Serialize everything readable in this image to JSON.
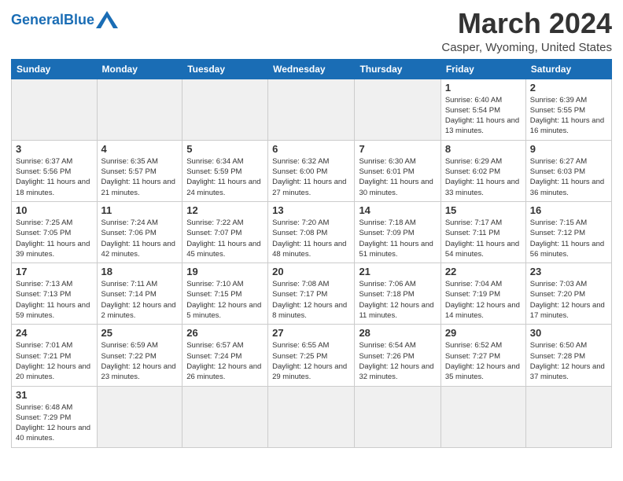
{
  "header": {
    "logo_text_general": "General",
    "logo_text_blue": "Blue",
    "month_title": "March 2024",
    "location": "Casper, Wyoming, United States"
  },
  "weekdays": [
    "Sunday",
    "Monday",
    "Tuesday",
    "Wednesday",
    "Thursday",
    "Friday",
    "Saturday"
  ],
  "weeks": [
    [
      {
        "day": "",
        "info": ""
      },
      {
        "day": "",
        "info": ""
      },
      {
        "day": "",
        "info": ""
      },
      {
        "day": "",
        "info": ""
      },
      {
        "day": "",
        "info": ""
      },
      {
        "day": "1",
        "info": "Sunrise: 6:40 AM\nSunset: 5:54 PM\nDaylight: 11 hours and 13 minutes."
      },
      {
        "day": "2",
        "info": "Sunrise: 6:39 AM\nSunset: 5:55 PM\nDaylight: 11 hours and 16 minutes."
      }
    ],
    [
      {
        "day": "3",
        "info": "Sunrise: 6:37 AM\nSunset: 5:56 PM\nDaylight: 11 hours and 18 minutes."
      },
      {
        "day": "4",
        "info": "Sunrise: 6:35 AM\nSunset: 5:57 PM\nDaylight: 11 hours and 21 minutes."
      },
      {
        "day": "5",
        "info": "Sunrise: 6:34 AM\nSunset: 5:59 PM\nDaylight: 11 hours and 24 minutes."
      },
      {
        "day": "6",
        "info": "Sunrise: 6:32 AM\nSunset: 6:00 PM\nDaylight: 11 hours and 27 minutes."
      },
      {
        "day": "7",
        "info": "Sunrise: 6:30 AM\nSunset: 6:01 PM\nDaylight: 11 hours and 30 minutes."
      },
      {
        "day": "8",
        "info": "Sunrise: 6:29 AM\nSunset: 6:02 PM\nDaylight: 11 hours and 33 minutes."
      },
      {
        "day": "9",
        "info": "Sunrise: 6:27 AM\nSunset: 6:03 PM\nDaylight: 11 hours and 36 minutes."
      }
    ],
    [
      {
        "day": "10",
        "info": "Sunrise: 7:25 AM\nSunset: 7:05 PM\nDaylight: 11 hours and 39 minutes."
      },
      {
        "day": "11",
        "info": "Sunrise: 7:24 AM\nSunset: 7:06 PM\nDaylight: 11 hours and 42 minutes."
      },
      {
        "day": "12",
        "info": "Sunrise: 7:22 AM\nSunset: 7:07 PM\nDaylight: 11 hours and 45 minutes."
      },
      {
        "day": "13",
        "info": "Sunrise: 7:20 AM\nSunset: 7:08 PM\nDaylight: 11 hours and 48 minutes."
      },
      {
        "day": "14",
        "info": "Sunrise: 7:18 AM\nSunset: 7:09 PM\nDaylight: 11 hours and 51 minutes."
      },
      {
        "day": "15",
        "info": "Sunrise: 7:17 AM\nSunset: 7:11 PM\nDaylight: 11 hours and 54 minutes."
      },
      {
        "day": "16",
        "info": "Sunrise: 7:15 AM\nSunset: 7:12 PM\nDaylight: 11 hours and 56 minutes."
      }
    ],
    [
      {
        "day": "17",
        "info": "Sunrise: 7:13 AM\nSunset: 7:13 PM\nDaylight: 11 hours and 59 minutes."
      },
      {
        "day": "18",
        "info": "Sunrise: 7:11 AM\nSunset: 7:14 PM\nDaylight: 12 hours and 2 minutes."
      },
      {
        "day": "19",
        "info": "Sunrise: 7:10 AM\nSunset: 7:15 PM\nDaylight: 12 hours and 5 minutes."
      },
      {
        "day": "20",
        "info": "Sunrise: 7:08 AM\nSunset: 7:17 PM\nDaylight: 12 hours and 8 minutes."
      },
      {
        "day": "21",
        "info": "Sunrise: 7:06 AM\nSunset: 7:18 PM\nDaylight: 12 hours and 11 minutes."
      },
      {
        "day": "22",
        "info": "Sunrise: 7:04 AM\nSunset: 7:19 PM\nDaylight: 12 hours and 14 minutes."
      },
      {
        "day": "23",
        "info": "Sunrise: 7:03 AM\nSunset: 7:20 PM\nDaylight: 12 hours and 17 minutes."
      }
    ],
    [
      {
        "day": "24",
        "info": "Sunrise: 7:01 AM\nSunset: 7:21 PM\nDaylight: 12 hours and 20 minutes."
      },
      {
        "day": "25",
        "info": "Sunrise: 6:59 AM\nSunset: 7:22 PM\nDaylight: 12 hours and 23 minutes."
      },
      {
        "day": "26",
        "info": "Sunrise: 6:57 AM\nSunset: 7:24 PM\nDaylight: 12 hours and 26 minutes."
      },
      {
        "day": "27",
        "info": "Sunrise: 6:55 AM\nSunset: 7:25 PM\nDaylight: 12 hours and 29 minutes."
      },
      {
        "day": "28",
        "info": "Sunrise: 6:54 AM\nSunset: 7:26 PM\nDaylight: 12 hours and 32 minutes."
      },
      {
        "day": "29",
        "info": "Sunrise: 6:52 AM\nSunset: 7:27 PM\nDaylight: 12 hours and 35 minutes."
      },
      {
        "day": "30",
        "info": "Sunrise: 6:50 AM\nSunset: 7:28 PM\nDaylight: 12 hours and 37 minutes."
      }
    ],
    [
      {
        "day": "31",
        "info": "Sunrise: 6:48 AM\nSunset: 7:29 PM\nDaylight: 12 hours and 40 minutes."
      },
      {
        "day": "",
        "info": ""
      },
      {
        "day": "",
        "info": ""
      },
      {
        "day": "",
        "info": ""
      },
      {
        "day": "",
        "info": ""
      },
      {
        "day": "",
        "info": ""
      },
      {
        "day": "",
        "info": ""
      }
    ]
  ]
}
